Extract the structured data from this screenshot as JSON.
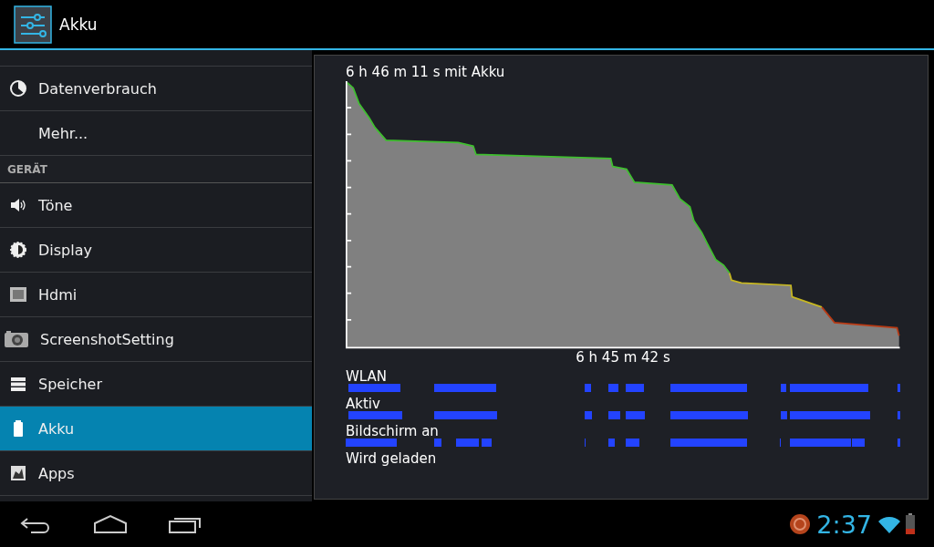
{
  "action_bar": {
    "title": "Akku"
  },
  "sidebar": {
    "items": [
      {
        "kind": "item",
        "label": "Datenverbrauch",
        "selected": false
      },
      {
        "kind": "item",
        "label": "Mehr...",
        "selected": false
      },
      {
        "kind": "header",
        "label": "GERÄT"
      },
      {
        "kind": "item",
        "label": "Töne",
        "selected": false
      },
      {
        "kind": "item",
        "label": "Display",
        "selected": false
      },
      {
        "kind": "item",
        "label": "Hdmi",
        "selected": false
      },
      {
        "kind": "item",
        "label": "ScreenshotSetting",
        "selected": false
      },
      {
        "kind": "item",
        "label": "Speicher",
        "selected": false
      },
      {
        "kind": "item",
        "label": "Akku",
        "selected": true
      },
      {
        "kind": "item",
        "label": "Apps",
        "selected": false
      }
    ]
  },
  "battery_panel": {
    "duration_label": "6 h 46 m 11 s mit Akku",
    "time_axis_label": "6 h 45 m 42 s",
    "signals": [
      {
        "label": "WLAN"
      },
      {
        "label": "Aktiv"
      },
      {
        "label": "Bildschirm an"
      },
      {
        "label": "Wird geladen"
      }
    ]
  },
  "status_bar": {
    "time": "2:37"
  }
}
